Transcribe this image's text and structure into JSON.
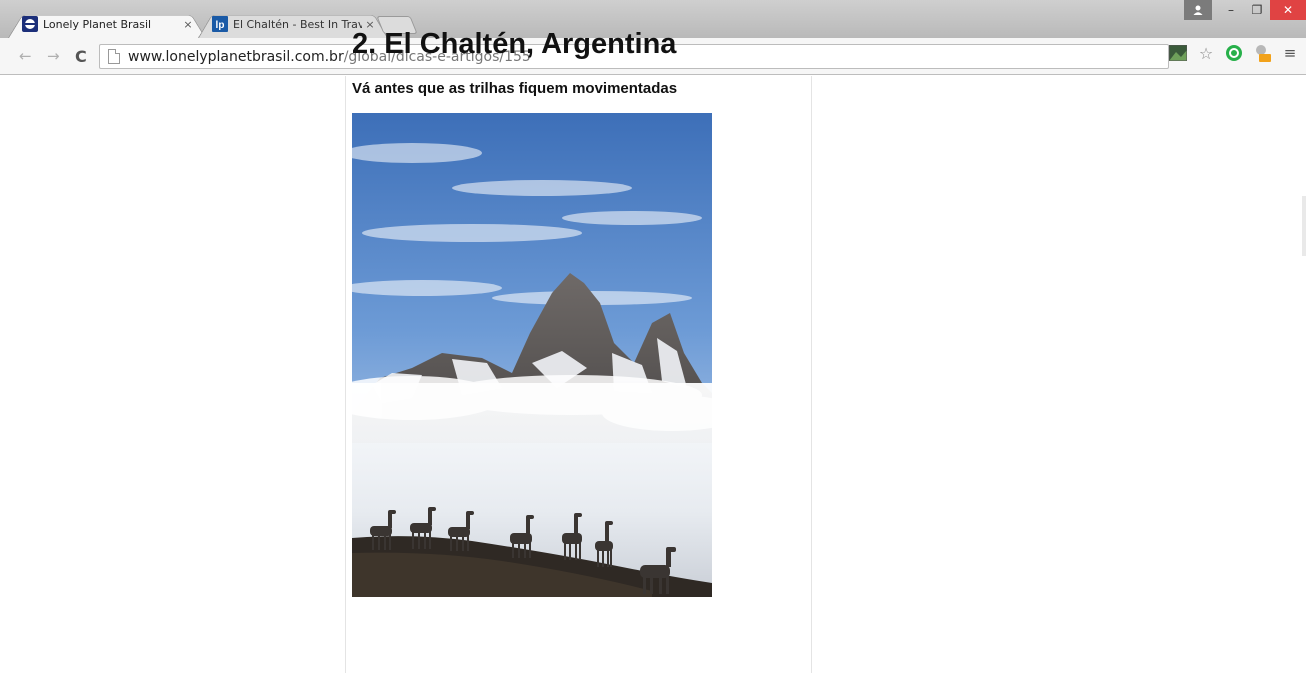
{
  "browser": {
    "tabs": [
      {
        "title": "Lonely Planet Brasil",
        "close": "×",
        "active": true,
        "favicon": "lonely-planet-globe-icon"
      },
      {
        "title": "El Chaltén - Best In Travel",
        "close": "×",
        "active": false,
        "favicon": "lp-logo-icon",
        "favicon_text": "lp"
      }
    ],
    "address": {
      "host": "www.lonelyplanetbrasil.com.br",
      "path": "/global/dicas-e-artigos/155"
    },
    "window_controls": {
      "minimize": "–",
      "maximize": "❐",
      "close": "✕"
    },
    "colors": {
      "close_button": "#e04343",
      "lp_favicon": "#1a5aa6"
    }
  },
  "article": {
    "heading": "2. El Chaltén, Argentina",
    "subheading": "Vá antes que as trilhas fiquem movimentadas",
    "photo": "mountain-with-guanacos-photo"
  }
}
